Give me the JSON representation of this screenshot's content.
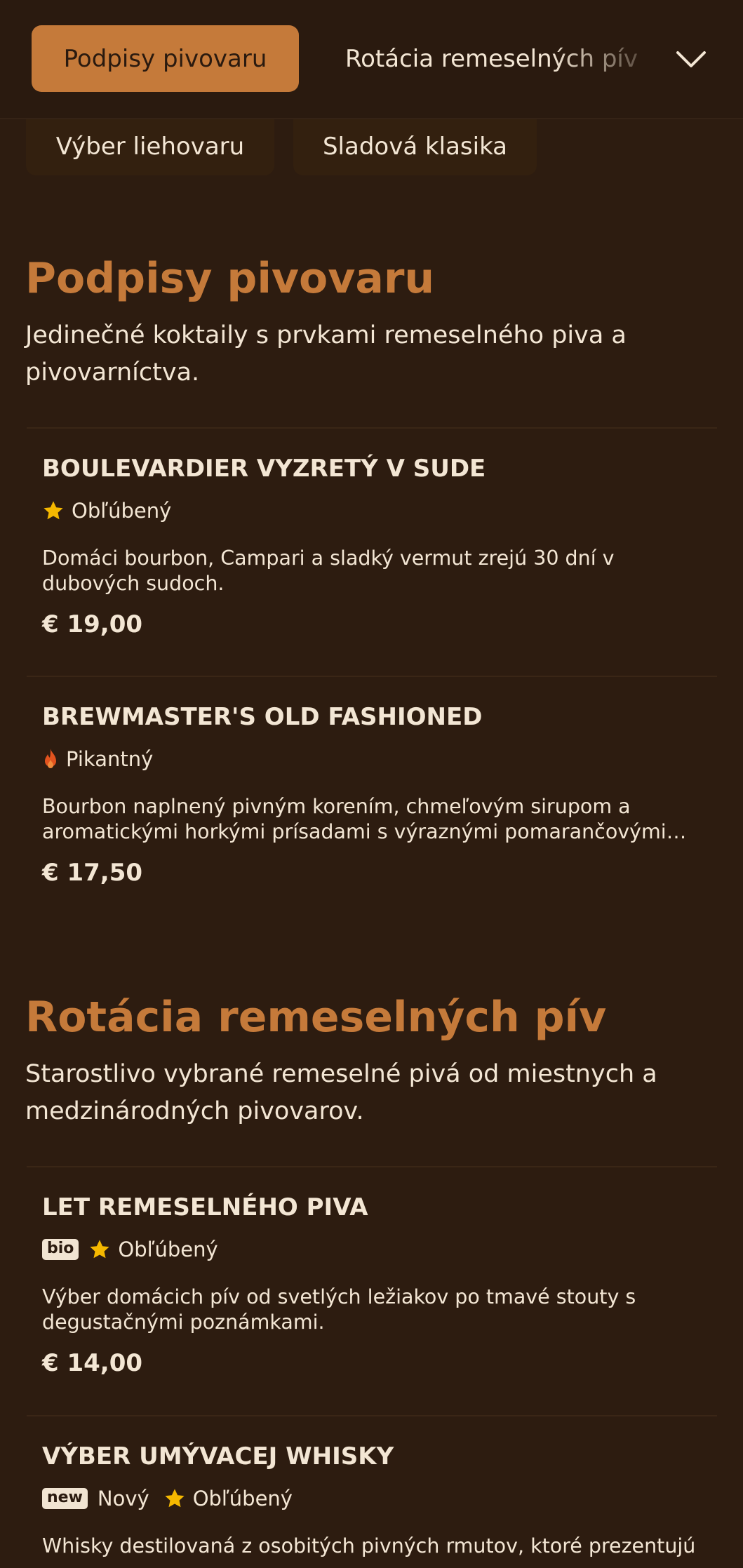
{
  "nav": {
    "active_tab": "Podpisy pivovaru",
    "next_tab": "Rotácia remeselných pív",
    "pills": [
      "Výber liehovaru",
      "Sladová klasika"
    ]
  },
  "sections": [
    {
      "title": "Podpisy pivovaru",
      "description": "Jedinečné koktaily s prvkami remeselného piva a pivovarníctva.",
      "items": [
        {
          "name": "BOULEVARDIER VYZRETÝ V SUDE",
          "tag": "Obľúbený",
          "tag_icon": "star-icon",
          "description": "Domáci bourbon, Campari a sladký vermut zrejú 30 dní v dubových sudoch.",
          "price": "€ 19,00"
        },
        {
          "name": "BREWMASTER'S OLD FASHIONED",
          "tag": "Pikantný",
          "tag_icon": "flame-icon",
          "description": "Bourbon naplnený pivným korením, chmeľovým sirupom a aromatickými horkými prísadami s výraznými pomarančovými tónmi.",
          "price": "€ 17,50"
        }
      ]
    },
    {
      "title": "Rotácia remeselných pív",
      "description": "Starostlivo vybrané remeselné pivá od miestnych a medzinárodných pivovarov.",
      "items": [
        {
          "name": "LET REMESELNÉHO PIVA",
          "badge": "bio",
          "tag": "Obľúbený",
          "tag_icon": "star-icon",
          "description": "Výber domácich pív od svetlých ležiakov po tmavé stouty s degustačnými poznámkami.",
          "price": "€ 14,00"
        },
        {
          "name": "VÝBER UMÝVACEJ WHISKY",
          "badge": "new",
          "badge_label": "Nový",
          "tag": "Obľúbený",
          "tag_icon": "star-icon",
          "description": "Whisky destilovaná z osobitých pivných rmutov, ktoré prezentujú"
        }
      ]
    }
  ],
  "colors": {
    "background": "#2d1c10",
    "accent": "#c57a3a",
    "text": "#f3e6d4",
    "star": "#f5b800",
    "flame": "#e2531e"
  }
}
